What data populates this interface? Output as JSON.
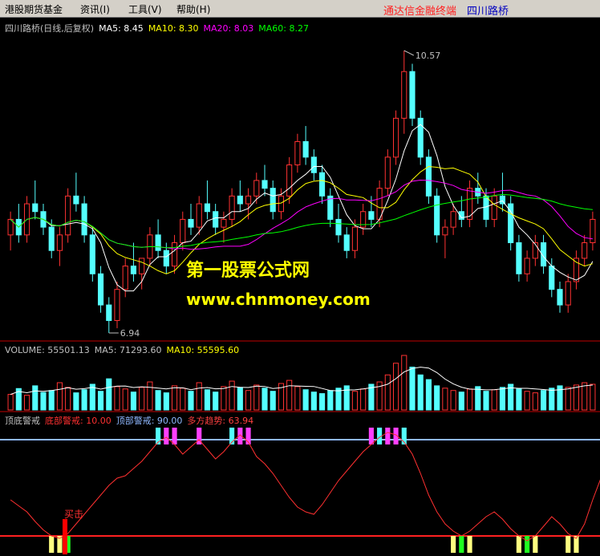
{
  "menubar": {
    "items": [
      {
        "label": "港股期货基金"
      },
      {
        "label": "资讯(I)"
      },
      {
        "label": "工具(V)"
      },
      {
        "label": "帮助(H)"
      }
    ],
    "brand_left": "通达信金融终端",
    "brand_right": "四川路桥"
  },
  "price_panel": {
    "title": "四川路桥(日线,后复权)",
    "ma5": "MA5: 8.45",
    "ma10": "MA10: 8.30",
    "ma20": "MA20: 8.03",
    "ma60": "MA60: 8.27",
    "high_label": "10.57",
    "low_label": "6.94"
  },
  "volume_panel": {
    "title": "VOLUME: 55501.13",
    "ma5": "MA5: 71293.60",
    "ma10": "MA10: 55595.60"
  },
  "indicator_panel": {
    "title": "顶底警戒",
    "bottom": "底部警戒: 10.00",
    "top": "顶部警戒: 90.00",
    "trend": "多方趋势: 63.94",
    "signal_label": "买击"
  },
  "watermark": {
    "line1": "第一股票公式网",
    "line2": "www.chnmoney.com"
  },
  "colors": {
    "up": "#ff3232",
    "down": "#54ffff",
    "ma5": "#ffffff",
    "ma10": "#ffff00",
    "ma20": "#ff00ff",
    "ma60": "#00ff00",
    "top_line": "#8fb8ff",
    "bottom_line": "#ff2020",
    "magenta_bar": "#ff40ff",
    "cyan_bar": "#54ffff",
    "yellow_bar": "#ffff80",
    "green_bar": "#20ff20"
  },
  "chart_data": {
    "type": "candlestick",
    "price_range": [
      6.94,
      10.57
    ],
    "candles": [
      [
        8.2,
        8.5,
        8.0,
        8.4
      ],
      [
        8.4,
        8.6,
        8.1,
        8.2
      ],
      [
        8.2,
        8.7,
        8.1,
        8.6
      ],
      [
        8.6,
        8.9,
        8.4,
        8.5
      ],
      [
        8.5,
        8.6,
        8.2,
        8.3
      ],
      [
        8.3,
        8.4,
        7.9,
        8.0
      ],
      [
        8.0,
        8.3,
        7.8,
        8.2
      ],
      [
        8.2,
        8.8,
        8.1,
        8.7
      ],
      [
        8.7,
        9.0,
        8.5,
        8.6
      ],
      [
        8.6,
        8.7,
        8.1,
        8.2
      ],
      [
        8.2,
        8.3,
        7.6,
        7.7
      ],
      [
        7.7,
        7.8,
        7.2,
        7.3
      ],
      [
        7.3,
        7.4,
        6.94,
        7.1
      ],
      [
        7.1,
        7.6,
        7.0,
        7.5
      ],
      [
        7.5,
        7.9,
        7.4,
        7.8
      ],
      [
        7.8,
        8.1,
        7.6,
        7.7
      ],
      [
        7.7,
        7.9,
        7.5,
        7.9
      ],
      [
        7.9,
        8.3,
        7.8,
        8.2
      ],
      [
        8.2,
        8.4,
        7.9,
        8.0
      ],
      [
        8.0,
        8.1,
        7.7,
        7.8
      ],
      [
        7.8,
        8.2,
        7.7,
        8.1
      ],
      [
        8.1,
        8.5,
        8.0,
        8.4
      ],
      [
        8.4,
        8.6,
        8.2,
        8.3
      ],
      [
        8.3,
        8.7,
        8.2,
        8.6
      ],
      [
        8.6,
        8.9,
        8.4,
        8.5
      ],
      [
        8.5,
        8.6,
        8.2,
        8.3
      ],
      [
        8.3,
        8.5,
        8.1,
        8.4
      ],
      [
        8.4,
        8.8,
        8.3,
        8.7
      ],
      [
        8.7,
        8.9,
        8.5,
        8.6
      ],
      [
        8.6,
        8.8,
        8.4,
        8.7
      ],
      [
        8.7,
        9.0,
        8.6,
        8.9
      ],
      [
        8.9,
        9.1,
        8.7,
        8.8
      ],
      [
        8.8,
        8.9,
        8.4,
        8.5
      ],
      [
        8.5,
        8.8,
        8.4,
        8.7
      ],
      [
        8.7,
        9.2,
        8.6,
        9.1
      ],
      [
        9.1,
        9.5,
        9.0,
        9.4
      ],
      [
        9.4,
        9.6,
        9.1,
        9.2
      ],
      [
        9.2,
        9.3,
        8.9,
        9.0
      ],
      [
        9.0,
        9.1,
        8.6,
        8.7
      ],
      [
        8.7,
        8.8,
        8.3,
        8.4
      ],
      [
        8.4,
        8.6,
        8.1,
        8.2
      ],
      [
        8.2,
        8.3,
        7.9,
        8.0
      ],
      [
        8.0,
        8.4,
        7.9,
        8.3
      ],
      [
        8.3,
        8.6,
        8.2,
        8.5
      ],
      [
        8.5,
        8.7,
        8.3,
        8.4
      ],
      [
        8.4,
        8.9,
        8.3,
        8.8
      ],
      [
        8.8,
        9.3,
        8.7,
        9.2
      ],
      [
        9.2,
        9.8,
        9.1,
        9.7
      ],
      [
        9.7,
        10.57,
        9.5,
        10.3
      ],
      [
        10.3,
        10.4,
        9.6,
        9.7
      ],
      [
        9.7,
        9.8,
        9.1,
        9.2
      ],
      [
        9.2,
        9.3,
        8.6,
        8.7
      ],
      [
        8.7,
        8.8,
        8.1,
        8.2
      ],
      [
        8.2,
        8.4,
        7.9,
        8.3
      ],
      [
        8.3,
        8.6,
        8.2,
        8.5
      ],
      [
        8.5,
        8.7,
        8.3,
        8.4
      ],
      [
        8.4,
        8.9,
        8.3,
        8.8
      ],
      [
        8.8,
        9.0,
        8.6,
        8.7
      ],
      [
        8.7,
        8.8,
        8.3,
        8.4
      ],
      [
        8.4,
        8.8,
        8.3,
        8.7
      ],
      [
        8.7,
        9.0,
        8.5,
        8.6
      ],
      [
        8.6,
        8.7,
        8.0,
        8.1
      ],
      [
        8.1,
        8.2,
        7.6,
        7.7
      ],
      [
        7.7,
        8.0,
        7.6,
        7.9
      ],
      [
        7.9,
        8.2,
        7.8,
        8.1
      ],
      [
        8.1,
        8.2,
        7.7,
        7.8
      ],
      [
        7.8,
        7.9,
        7.4,
        7.5
      ],
      [
        7.5,
        7.6,
        7.2,
        7.3
      ],
      [
        7.3,
        7.7,
        7.2,
        7.6
      ],
      [
        7.6,
        8.0,
        7.5,
        7.9
      ],
      [
        7.9,
        8.2,
        7.8,
        8.1
      ],
      [
        8.1,
        8.5,
        8.0,
        8.4
      ]
    ],
    "volume": [
      40,
      55,
      38,
      62,
      45,
      50,
      70,
      58,
      44,
      52,
      66,
      48,
      80,
      60,
      54,
      46,
      58,
      72,
      50,
      44,
      62,
      56,
      48,
      70,
      52,
      46,
      60,
      74,
      58,
      50,
      64,
      56,
      48,
      68,
      76,
      60,
      52,
      46,
      42,
      50,
      56,
      62,
      48,
      54,
      66,
      72,
      90,
      120,
      140,
      110,
      90,
      78,
      62,
      56,
      50,
      46,
      54,
      60,
      48,
      52,
      58,
      66,
      54,
      48,
      44,
      50,
      56,
      62,
      58,
      64,
      70,
      66
    ],
    "trend": [
      40,
      35,
      30,
      22,
      15,
      10,
      8,
      12,
      20,
      28,
      36,
      44,
      52,
      58,
      60,
      66,
      72,
      80,
      88,
      92,
      86,
      78,
      84,
      90,
      82,
      74,
      80,
      88,
      94,
      88,
      76,
      70,
      62,
      52,
      42,
      34,
      30,
      28,
      36,
      46,
      56,
      64,
      72,
      80,
      86,
      92,
      96,
      94,
      88,
      78,
      62,
      44,
      30,
      20,
      14,
      10,
      14,
      20,
      26,
      30,
      24,
      16,
      10,
      6,
      10,
      18,
      26,
      20,
      12,
      8,
      20,
      40,
      58,
      64
    ]
  }
}
